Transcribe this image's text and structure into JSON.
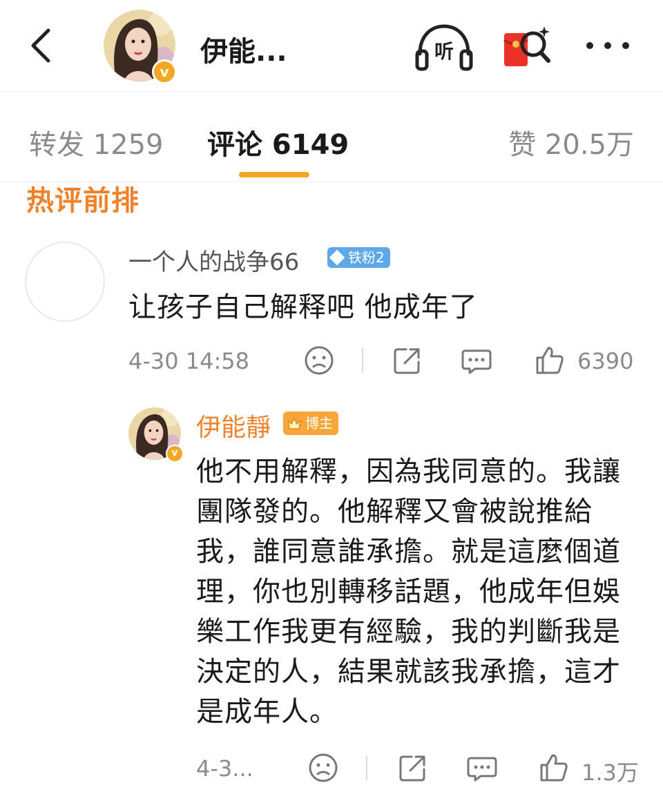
{
  "header": {
    "name": "伊能...",
    "listen_label": "听",
    "avatar_badge": "v"
  },
  "tabs": {
    "repost": "转发 1259",
    "comment": "评论 6149",
    "like": "赞 20.5万"
  },
  "section_title": "热评前排",
  "comment": {
    "user": "一个人的战争66",
    "fan_badge": "铁粉2",
    "text": "让孩子自己解释吧  他成年了",
    "time": "4-30 14:58",
    "likes": "6390"
  },
  "reply": {
    "user": "伊能靜",
    "role_badge": "博主",
    "avatar_badge": "v",
    "text": "他不用解釋，因為我同意的。我讓團隊發的。他解釋又會被說推給我，誰同意誰承擔。就是這麼個道理，你也別轉移話題，他成年但娛樂工作我更有經驗，我的判斷我是決定的人，結果就該我承擔，這才是成年人。",
    "time": "4-3...",
    "likes": "1.3万"
  },
  "colors": {
    "accent": "#f5a623",
    "hot_title": "#f0822a",
    "fan_badge": "#5fa8e8",
    "blogger_badge": "#f7a73a"
  },
  "icons": [
    "back-icon",
    "headphones-icon",
    "red-packet-search-icon",
    "more-icon",
    "sad-face-icon",
    "share-icon",
    "comment-icon",
    "thumbs-up-icon"
  ]
}
